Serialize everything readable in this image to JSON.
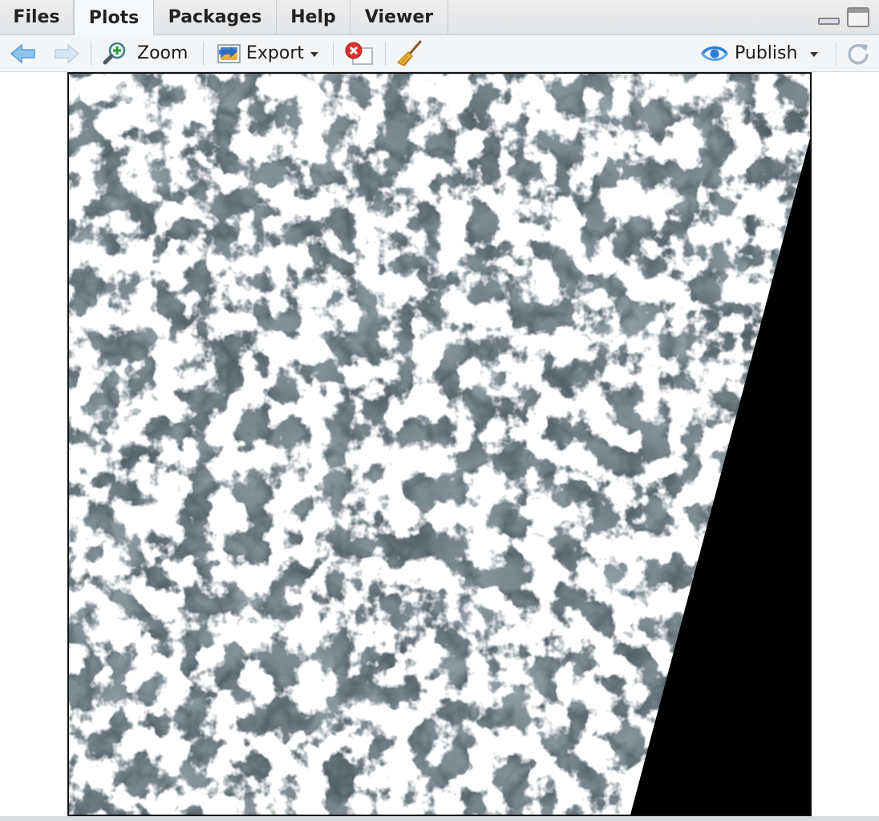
{
  "tabs": [
    {
      "label": "Files",
      "active": false
    },
    {
      "label": "Plots",
      "active": true
    },
    {
      "label": "Packages",
      "active": false
    },
    {
      "label": "Help",
      "active": false
    },
    {
      "label": "Viewer",
      "active": false
    }
  ],
  "toolbar": {
    "zoom_label": "Zoom",
    "export_label": "Export",
    "publish_label": "Publish"
  },
  "icons": {
    "back": "arrow-left-icon",
    "forward": "arrow-right-icon",
    "zoom": "magnifier-plus-icon",
    "export": "export-image-icon",
    "remove": "remove-plot-icon",
    "clear": "broom-icon",
    "publish": "publish-eye-icon",
    "refresh": "refresh-icon"
  },
  "colors": {
    "accent": "#2f7fd1",
    "tab_bg": "#e6e8ea",
    "toolbar_bg": "#f4f5f6"
  },
  "plot": {
    "type": "satellite-raster-rgb"
  }
}
